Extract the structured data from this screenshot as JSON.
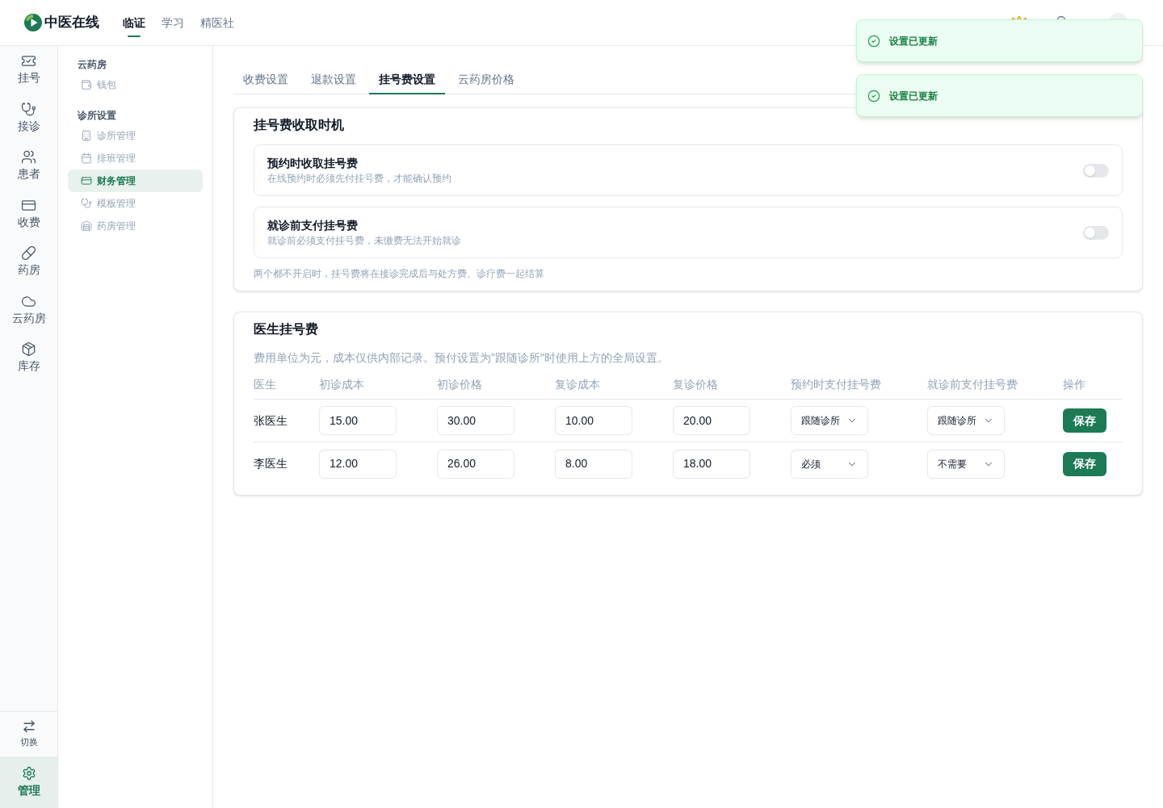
{
  "header": {
    "logo_text": "中医在线",
    "nav": [
      {
        "label": "临证",
        "selected": true
      },
      {
        "label": "学习",
        "selected": false
      },
      {
        "label": "精医社",
        "selected": false
      }
    ]
  },
  "rail": {
    "items": [
      {
        "label": "挂号",
        "selected": false
      },
      {
        "label": "接诊",
        "selected": false
      },
      {
        "label": "患者",
        "selected": false
      },
      {
        "label": "收费",
        "selected": false
      },
      {
        "label": "药房",
        "selected": false
      },
      {
        "label": "云药房",
        "selected": false
      },
      {
        "label": "库存",
        "selected": false
      }
    ],
    "footer_items": [
      {
        "kind": "switch",
        "label": "切换",
        "selected": false
      },
      {
        "kind": "settings",
        "label": "管理",
        "selected": true
      }
    ]
  },
  "sidebar": {
    "groups": [
      {
        "title": "云药房",
        "items": [
          {
            "label": "钱包",
            "selected": false
          }
        ]
      },
      {
        "title": "诊所设置",
        "items": [
          {
            "label": "诊所管理",
            "selected": false
          },
          {
            "label": "排班管理",
            "selected": false
          },
          {
            "label": "财务管理",
            "selected": true
          },
          {
            "label": "模板管理",
            "selected": false
          },
          {
            "label": "药房管理",
            "selected": false
          }
        ]
      }
    ]
  },
  "tabs": [
    {
      "label": "收费设置",
      "selected": false
    },
    {
      "label": "退款设置",
      "selected": false
    },
    {
      "label": "挂号费设置",
      "selected": true
    },
    {
      "label": "云药房价格",
      "selected": false
    }
  ],
  "timing_card": {
    "title": "挂号费收取时机",
    "options": [
      {
        "title": "预约时收取挂号费",
        "description": "在线预约时必须先付挂号费，才能确认预约",
        "enabled": false
      },
      {
        "title": "就诊前支付挂号费",
        "description": "就诊前必须支付挂号费，未缴费无法开始就诊",
        "enabled": false
      }
    ],
    "note": "两个都不开启时，挂号费将在接诊完成后与处方费、诊疗费一起结算"
  },
  "fee_card": {
    "title": "医生挂号费",
    "description": "费用单位为元，成本仅供内部记录。预付设置为\"跟随诊所\"时使用上方的全局设置。",
    "table": {
      "columns": [
        "医生",
        "初诊成本",
        "初诊价格",
        "复诊成本",
        "复诊价格",
        "预约时支付挂号费",
        "就诊前支付挂号费",
        "操作"
      ],
      "rows": [
        {
          "doctor": "张医生",
          "first_visit_cost": "15.00",
          "first_visit_price": "30.00",
          "return_visit_cost": "10.00",
          "return_visit_price": "20.00",
          "booking_payment": "跟随诊所",
          "pre_visit_payment": "跟随诊所",
          "action": "保存"
        },
        {
          "doctor": "李医生",
          "first_visit_cost": "12.00",
          "first_visit_price": "26.00",
          "return_visit_cost": "8.00",
          "return_visit_price": "18.00",
          "booking_payment": "必须",
          "pre_visit_payment": "不需要",
          "action": "保存"
        }
      ]
    }
  },
  "toasts": [
    {
      "message": "设置已更新"
    },
    {
      "message": "设置已更新"
    }
  ]
}
